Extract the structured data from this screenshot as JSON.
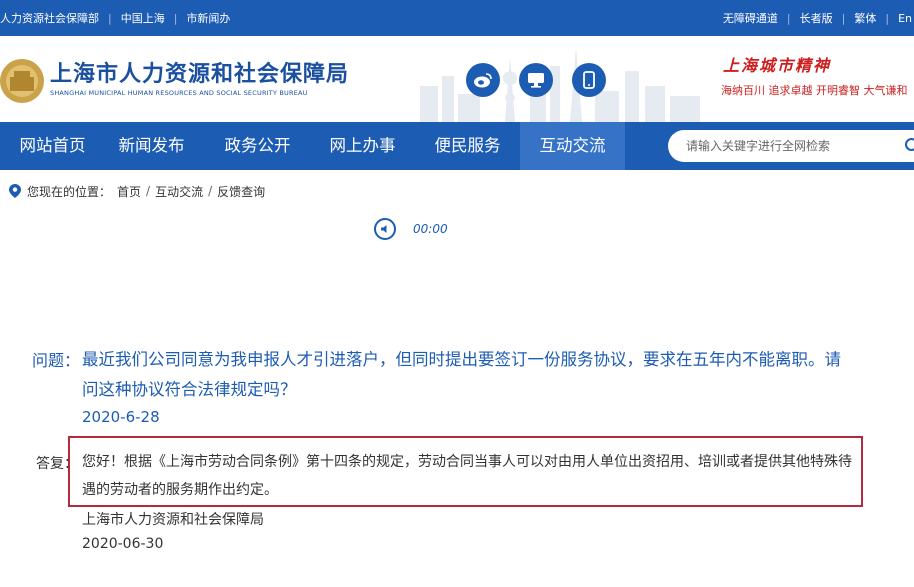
{
  "topbar": {
    "left_links": [
      "人力资源社会保障部",
      "中国上海",
      "市新闻办"
    ],
    "right_links": [
      "无障碍通道",
      "长者版",
      "繁体",
      "En"
    ]
  },
  "header": {
    "title": "上海市人力资源和社会保障局",
    "subtitle": "SHANGHAI MUNICIPAL HUMAN RESOURCES AND SOCIAL SECURITY BUREAU",
    "social_icons": [
      "weibo-icon",
      "computer-icon",
      "mobile-icon"
    ],
    "spirit_title": "上海城市精神",
    "spirit_text": "海纳百川  追求卓越  开明睿智  大气谦和"
  },
  "nav": {
    "items": [
      {
        "label": "网站首页",
        "active": false
      },
      {
        "label": "新闻发布",
        "active": false
      },
      {
        "label": "政务公开",
        "active": false
      },
      {
        "label": "网上办事",
        "active": false
      },
      {
        "label": "便民服务",
        "active": false
      },
      {
        "label": "互动交流",
        "active": true
      }
    ],
    "search_placeholder": "请输入关键字进行全网检索"
  },
  "breadcrumb": {
    "prefix": "您现在的位置：",
    "items": [
      "首页",
      "互动交流",
      "反馈查询"
    ]
  },
  "audio": {
    "time": "00:00"
  },
  "qa": {
    "question_label": "问题：",
    "question_text": "最近我们公司同意为我申报人才引进落户，但同时提出要签订一份服务协议，要求在五年内不能离职。请问这种协议符合法律规定吗？",
    "question_date": "2020-6-28",
    "answer_label": "答复：",
    "answer_text": "您好！根据《上海市劳动合同条例》第十四条的规定，劳动合同当事人可以对由用人单位出资招用、培训或者提供其他特殊待遇的劳动者的服务期作出约定。",
    "answer_org": "上海市人力资源和社会保障局",
    "answer_date": "2020-06-30"
  },
  "colors": {
    "brand_blue": "#1d5cb3",
    "nav_active": "#3673c7",
    "highlight_box": "#b4293f",
    "spirit_red": "#cc1f1f"
  }
}
